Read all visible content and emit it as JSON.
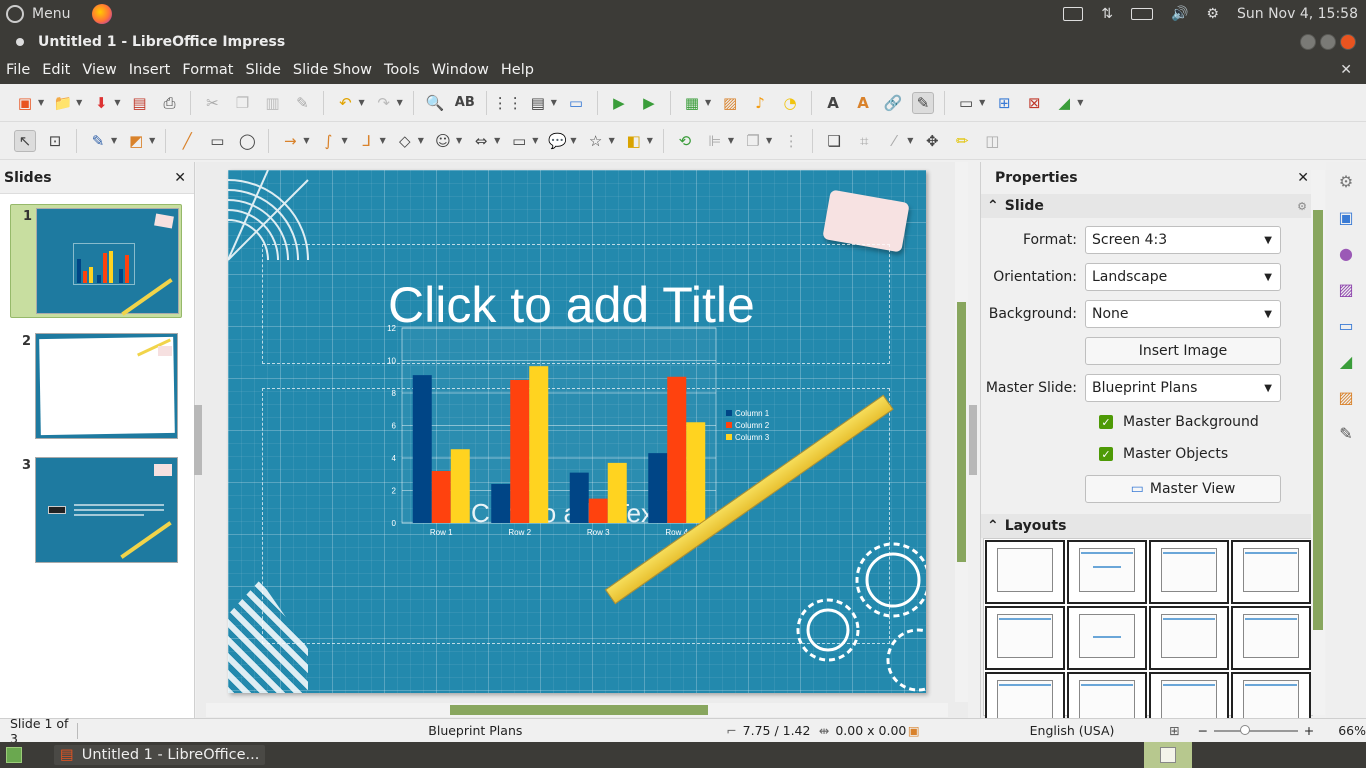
{
  "system": {
    "menu_label": "Menu",
    "clock": "Sun Nov  4, 15:58"
  },
  "window": {
    "title": "Untitled 1 - LibreOffice Impress"
  },
  "menubar": {
    "items": [
      "File",
      "Edit",
      "View",
      "Insert",
      "Format",
      "Slide",
      "Slide Show",
      "Tools",
      "Window",
      "Help"
    ]
  },
  "slides_pane": {
    "title": "Slides",
    "numbers": [
      "1",
      "2",
      "3"
    ]
  },
  "slide": {
    "title_placeholder": "Click to add Title",
    "text_placeholder": "Click to add Text"
  },
  "chart_data": {
    "type": "bar",
    "categories": [
      "Row 1",
      "Row 2",
      "Row 3",
      "Row 4"
    ],
    "ylim": [
      0,
      12
    ],
    "yticks": [
      "0",
      "2",
      "4",
      "6",
      "8",
      "10",
      "12"
    ],
    "series": [
      {
        "name": "Column 1",
        "color": "#004586",
        "values": [
          9.1,
          2.4,
          3.1,
          4.3
        ]
      },
      {
        "name": "Column 2",
        "color": "#ff420e",
        "values": [
          3.2,
          8.8,
          1.5,
          9
        ]
      },
      {
        "name": "Column 3",
        "color": "#ffd320",
        "values": [
          4.54,
          9.65,
          3.7,
          6.2
        ]
      }
    ],
    "legend_position": "right"
  },
  "properties": {
    "title": "Properties",
    "slide_section": "Slide",
    "format_label": "Format:",
    "format_value": "Screen 4:3",
    "orientation_label": "Orientation:",
    "orientation_value": "Landscape",
    "background_label": "Background:",
    "background_value": "None",
    "insert_image": "Insert Image",
    "master_slide_label": "Master Slide:",
    "master_slide_value": "Blueprint Plans",
    "master_background": "Master Background",
    "master_objects": "Master Objects",
    "master_view": "Master View",
    "layouts_section": "Layouts"
  },
  "status": {
    "slide_of": "Slide 1 of 3",
    "master": "Blueprint Plans",
    "position": "7.75 / 1.42",
    "size": "0.00 x 0.00",
    "language": "English (USA)",
    "zoom": "66%"
  },
  "taskbar": {
    "entry": "Untitled 1 - LibreOffice..."
  },
  "colors": {
    "panel": "#3c3b37",
    "accent_green": "#88a65e",
    "slide_bg": "#2389ad"
  }
}
